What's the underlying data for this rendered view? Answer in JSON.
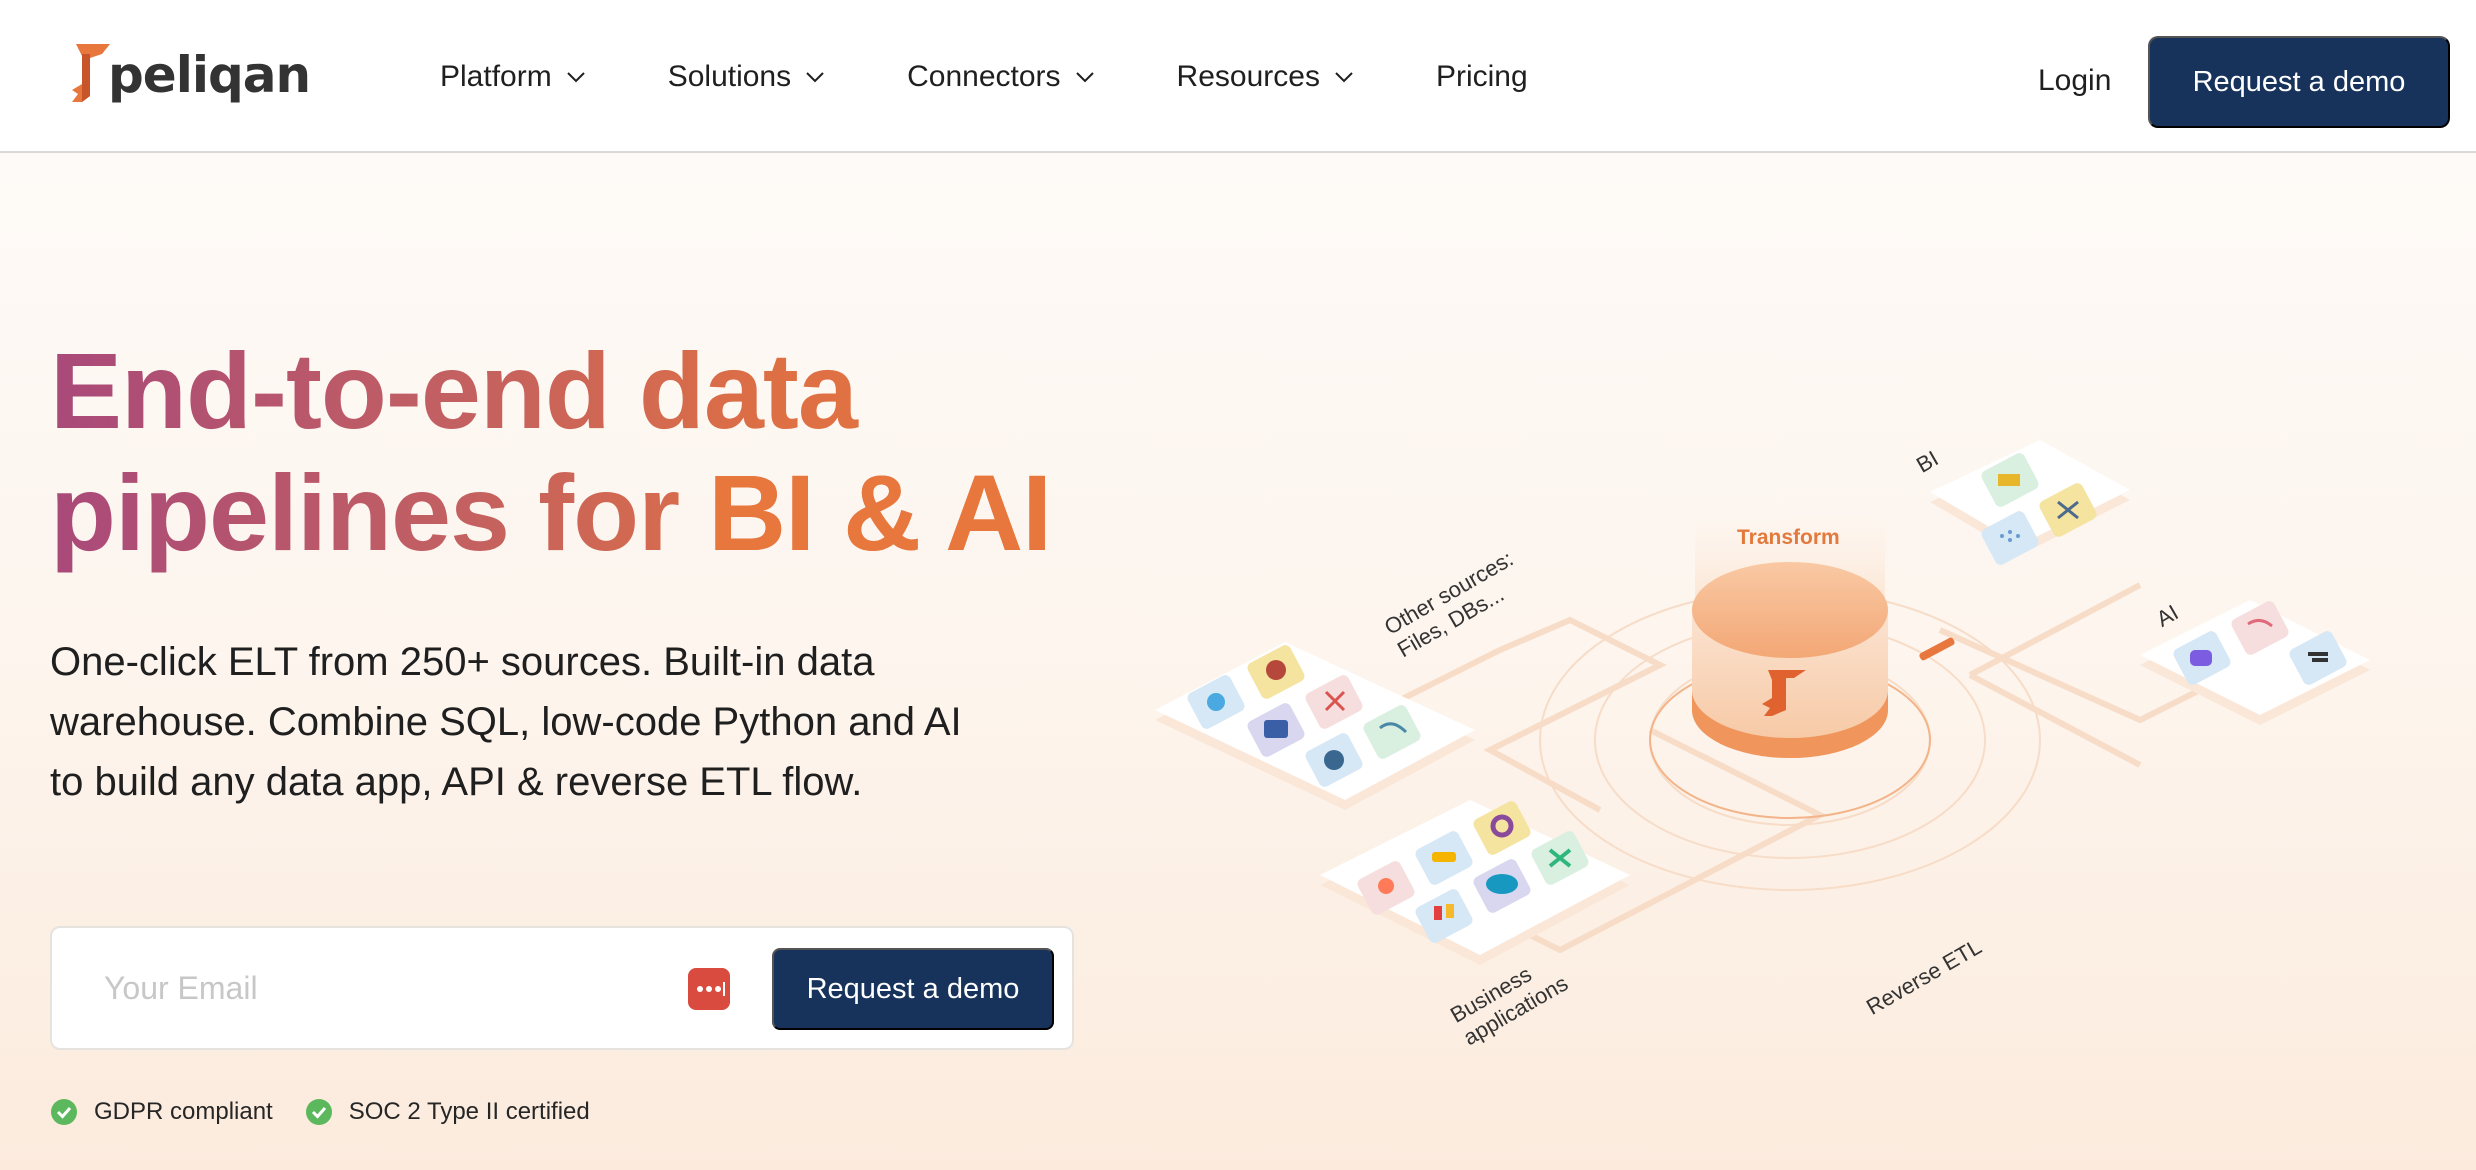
{
  "brand": {
    "name": "peliqan"
  },
  "nav": {
    "items": [
      {
        "label": "Platform",
        "has_dropdown": true
      },
      {
        "label": "Solutions",
        "has_dropdown": true
      },
      {
        "label": "Connectors",
        "has_dropdown": true
      },
      {
        "label": "Resources",
        "has_dropdown": true
      },
      {
        "label": "Pricing",
        "has_dropdown": false
      }
    ],
    "login": "Login",
    "cta": "Request a demo"
  },
  "hero": {
    "title_line1": "End-to-end data",
    "title_line2_start": "pipelines for ",
    "title_line2_accent": "BI & AI",
    "subtitle_line1": "One-click ELT from 250+ sources. Built-in data",
    "subtitle_line2": "warehouse. Combine SQL, low-code Python and AI",
    "subtitle_line3": "to build any data app, API & reverse ETL flow.",
    "email_placeholder": "Your Email",
    "email_cta": "Request a demo",
    "badges": [
      {
        "label": "GDPR compliant",
        "icon": "check-circle-icon"
      },
      {
        "label": "SOC 2 Type II certified",
        "icon": "check-circle-icon"
      }
    ]
  },
  "illustration": {
    "transform_label": "Transform",
    "labels": {
      "other_sources_line1": "Other sources:",
      "other_sources_line2": "Files, DBs...",
      "business_line1": "Business",
      "business_line2": "applications",
      "reverse_etl": "Reverse ETL",
      "bi": "BI",
      "ai": "AI"
    }
  },
  "colors": {
    "brand_navy": "#17335c",
    "brand_orange": "#e8773d",
    "title_gradient_start": "#a9497a",
    "success_green": "#5cb85c"
  }
}
